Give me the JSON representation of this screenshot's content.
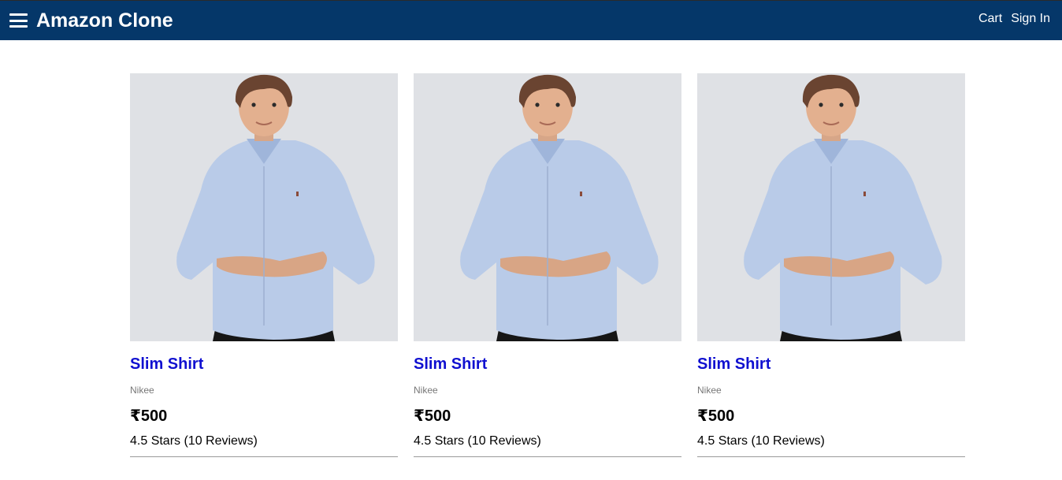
{
  "header": {
    "brand": "Amazon Clone",
    "cart_label": "Cart",
    "signin_label": "Sign In",
    "background_color": "#053769"
  },
  "products": [
    {
      "name": "Slim Shirt",
      "brand": "Nikee",
      "price": "₹500",
      "rating": "4.5 Stars (10 Reviews)"
    },
    {
      "name": "Slim Shirt",
      "brand": "Nikee",
      "price": "₹500",
      "rating": "4.5 Stars (10 Reviews)"
    },
    {
      "name": "Slim Shirt",
      "brand": "Nikee",
      "price": "₹500",
      "rating": "4.5 Stars (10 Reviews)"
    }
  ],
  "colors": {
    "link": "#1010d0",
    "shirt": "#b9cbe8",
    "image_bg": "#dfe1e5"
  }
}
